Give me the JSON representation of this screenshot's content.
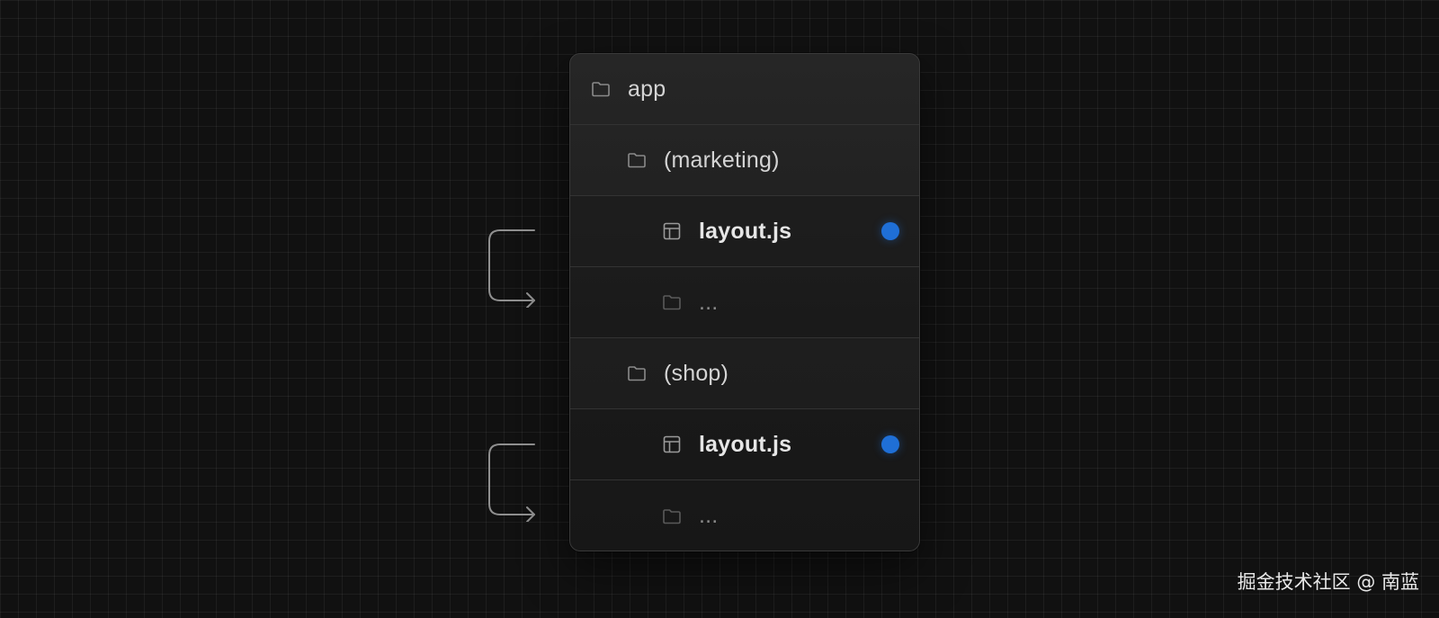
{
  "tree": {
    "rows": [
      {
        "label": "app",
        "icon": "folder-icon"
      },
      {
        "label": "(marketing)",
        "icon": "folder-icon"
      },
      {
        "label": "layout.js",
        "icon": "layout-file-icon",
        "status_color": "#1f6fd6"
      },
      {
        "label": "...",
        "icon": "folder-icon"
      },
      {
        "label": "(shop)",
        "icon": "folder-icon"
      },
      {
        "label": "layout.js",
        "icon": "layout-file-icon",
        "status_color": "#1f6fd6"
      },
      {
        "label": "...",
        "icon": "folder-icon"
      }
    ]
  },
  "watermark": {
    "text": "掘金技术社区 @ 南蓝"
  },
  "colors": {
    "background": "#111111",
    "panel": "#222222",
    "status_dot": "#1f6fd6",
    "connector": "#8f8f8f"
  }
}
